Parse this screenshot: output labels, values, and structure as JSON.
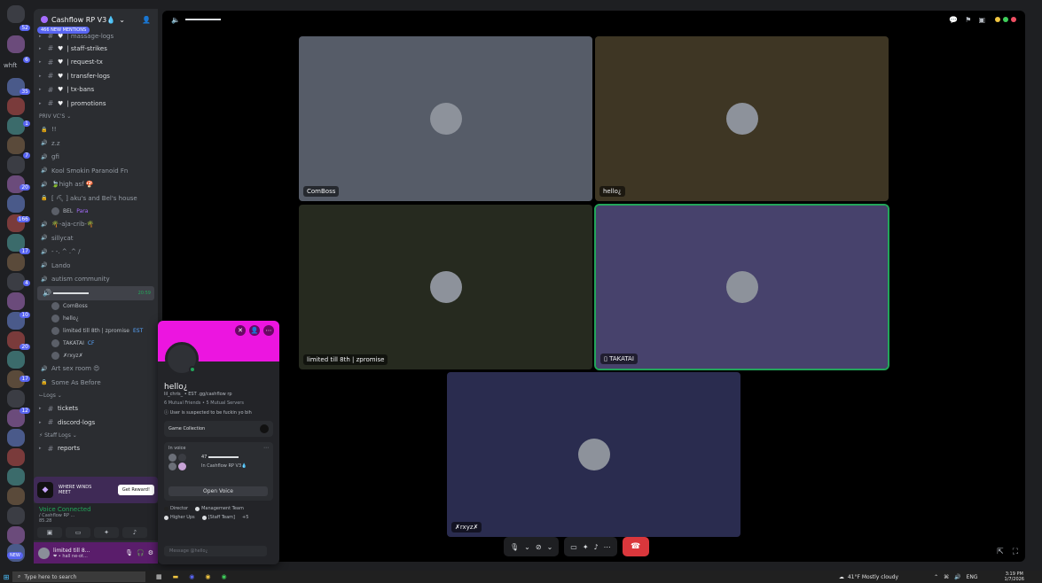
{
  "server": {
    "name": "Cashflow RP V3💧",
    "new_mentions": "466 NEW MENTIONS"
  },
  "rail": {
    "badges": [
      "52",
      "6",
      "35",
      "1",
      "7",
      "20",
      "166",
      "17",
      "4",
      "10",
      "20",
      "17",
      "12"
    ],
    "labels": [
      "whft"
    ],
    "new_label": "NEW"
  },
  "channels_top": [
    {
      "icon": "#",
      "heart": true,
      "name": "| staff-strikes"
    },
    {
      "icon": "#",
      "heart": true,
      "name": "| request-tx"
    },
    {
      "icon": "#",
      "heart": true,
      "name": "| transfer-logs"
    },
    {
      "icon": "#",
      "heart": true,
      "name": "| tx-bans"
    },
    {
      "icon": "#",
      "heart": true,
      "name": "| promotions"
    }
  ],
  "priv_vc_label": "PRIV VC'S",
  "voice_channels": [
    {
      "name": "!!"
    },
    {
      "name": "z.z"
    },
    {
      "name": "gfi"
    },
    {
      "name": "Kool Smokin Paranoid Fn"
    },
    {
      "name": "🍃high asf 🍄"
    },
    {
      "name": "[ ⛏ ] aku's and Bel's house"
    }
  ],
  "bel_member": {
    "name": "BEL",
    "tag": "Para"
  },
  "voice_channels_2": [
    {
      "name": "🌴-aja-crib-🌴"
    },
    {
      "name": "sillycat"
    },
    {
      "name": "- -. ^ .^ /"
    },
    {
      "name": "Lando"
    },
    {
      "name": "autism community"
    }
  ],
  "active_vc": {
    "time": "20:59"
  },
  "vc_members": [
    {
      "name": "ComBoss"
    },
    {
      "name": "hello¿"
    },
    {
      "name": "limited till 8th | zpromise",
      "tag": "EST"
    },
    {
      "name": "TAKATAI",
      "tag": "CF"
    },
    {
      "name": "✗rxyz✗"
    }
  ],
  "channels_bottom": [
    {
      "name": "Art sex room 😍"
    },
    {
      "name": "Some As Before"
    }
  ],
  "logs_label": "Logs",
  "logs_channels": [
    {
      "name": "tickets"
    },
    {
      "name": "discord-logs"
    }
  ],
  "staff_logs_label": "⚡ Staff Logs",
  "staff_logs_channels": [
    {
      "name": "reports"
    }
  ],
  "promo": {
    "text": "WHERE WINDS MEET",
    "button": "Get Reward!"
  },
  "voice_panel": {
    "status": "Voice Connected",
    "channel": "/ Cashflow RP ...",
    "ping": "85.28"
  },
  "user_panel": {
    "name": "limited till 8...",
    "status": "❤ • hall ne-ot..."
  },
  "profile": {
    "name": "hello¿",
    "tag": "lil_chris_ • EST .gg/cashflow rp",
    "mutual": "6 Mutual Friends • 5 Mutual Servers",
    "note": "ⓘ User is suspected to be fuckin yo bih",
    "game_card": "Game Collection",
    "in_voice_label": "In voice",
    "voice_name": "47",
    "voice_server": "In Cashflow RP V3💧",
    "open_voice": "Open Voice",
    "roles": [
      "Director",
      "Management Team",
      "Higher Ups",
      "[Staff Team]",
      "+5"
    ],
    "message_placeholder": "Message @hello¿"
  },
  "tiles": [
    {
      "label": "ComBoss"
    },
    {
      "label": "hello¿"
    },
    {
      "label": "limited till 8th | zpromise"
    },
    {
      "label": "TAKATAI"
    },
    {
      "label": "✗rxyz✗"
    }
  ],
  "colors": {
    "tile_1": "#565c68",
    "tile_2": "#3e3624",
    "tile_3": "#262a1f",
    "tile_4": "#47426c",
    "tile_5": "#2a2c4f",
    "banner": "#ec15e0",
    "hangup": "#da373c",
    "green": "#23a55a"
  },
  "taskbar": {
    "search_placeholder": "Type here to search",
    "weather": "41°F  Mostly cloudy",
    "lang": "ENG",
    "time": "3:19 PM",
    "date": "1/7/2026"
  }
}
